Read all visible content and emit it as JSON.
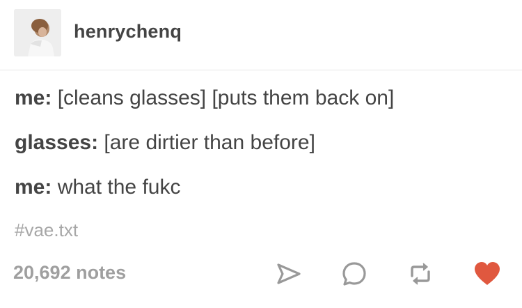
{
  "post": {
    "username": "henrychenq",
    "lines": [
      {
        "speaker": "me:",
        "text": " [cleans glasses] [puts them back on]"
      },
      {
        "speaker": "glasses:",
        "text": " [are dirtier than before]"
      },
      {
        "speaker": "me:",
        "text": " what the fukc"
      }
    ],
    "tag": "#vae.txt",
    "notes": "20,692 notes"
  },
  "actions": {
    "share_icon": "paper-plane-icon",
    "reply_icon": "speech-bubble-icon",
    "reblog_icon": "reblog-arrows-icon",
    "like_icon": "heart-icon"
  },
  "colors": {
    "text": "#444444",
    "muted": "#a7a7a7",
    "icon": "#999999",
    "liked": "#e0583f"
  }
}
